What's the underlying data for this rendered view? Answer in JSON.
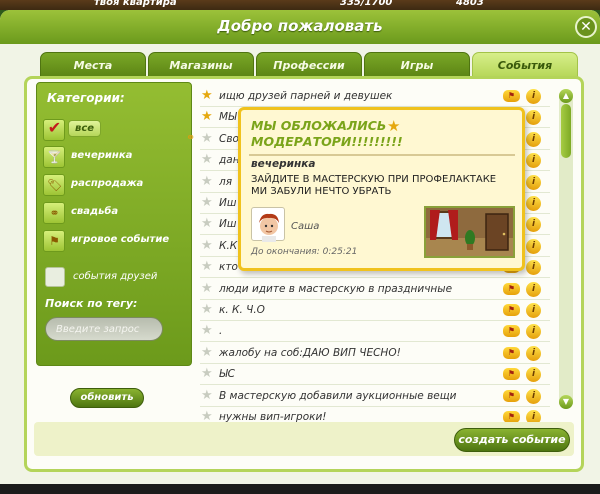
{
  "hud": {
    "apartment_label": "твоя квартира",
    "energy": "335/1700",
    "coins": "4803"
  },
  "window": {
    "title": "Добро пожаловать",
    "close_symbol": "✕"
  },
  "tabs": [
    {
      "label": "Места",
      "active": false
    },
    {
      "label": "Магазины",
      "active": false
    },
    {
      "label": "Профессии",
      "active": false
    },
    {
      "label": "Игры",
      "active": false
    },
    {
      "label": "События",
      "active": true
    }
  ],
  "sidebar": {
    "heading": "Категории:",
    "categories": [
      {
        "label": "все",
        "icon": "checkmark-icon",
        "checked": true
      },
      {
        "label": "вечеринка",
        "icon": "cocktail-icon"
      },
      {
        "label": "распродажа",
        "icon": "price-tag-icon"
      },
      {
        "label": "свадьба",
        "icon": "rings-icon"
      },
      {
        "label": "игровое событие",
        "icon": "game-flag-icon"
      }
    ],
    "friends_events_label": "события друзей",
    "search_heading": "Поиск по тегу:",
    "search_placeholder": "Введите запрос",
    "refresh_label": "обновить"
  },
  "events": [
    {
      "text": "ищю друзей парней и девушек",
      "starred": true
    },
    {
      "text": "МЫ",
      "starred": true
    },
    {
      "text": "Сво",
      "starred": false
    },
    {
      "text": "дан",
      "starred": false
    },
    {
      "text": "ля",
      "starred": false
    },
    {
      "text": "Иш",
      "starred": false
    },
    {
      "text": "Иш",
      "starred": false
    },
    {
      "text": "К.К",
      "starred": false
    },
    {
      "text": "кто",
      "starred": false
    },
    {
      "text": "люди идите в мастерскую в праздничные",
      "starred": false
    },
    {
      "text": "к. К. Ч.О",
      "starred": false
    },
    {
      "text": ".",
      "starred": false
    },
    {
      "text": "жалобу на соб:ДАЮ ВИП ЧЕСНО!",
      "starred": false
    },
    {
      "text": "ЫС",
      "starred": false
    },
    {
      "text": "В мастерскую добавили аукционные вещи",
      "starred": false
    },
    {
      "text": "нужны вип-игроки!",
      "starred": false
    }
  ],
  "row_info_symbol": "i",
  "popup": {
    "title": "МЫ ОБЛОЖАЛИСЬ МОДЕРАТОРИ!!!!!!!!!",
    "category": "вечеринка",
    "description": "ЗАЙДИТЕ В МАСТЕРСКУЮ ПРИ ПРОФЕЛАКТАКЕ МИ ЗАБУЛИ НЕЧТО УБРАТЬ",
    "author": "Саша",
    "time_left": "До окончания: 0:25:21"
  },
  "create_event_label": "создать событие",
  "colors": {
    "accent_green": "#7ba41a",
    "gold": "#f0c21d",
    "star_gold": "#e5a80e"
  }
}
